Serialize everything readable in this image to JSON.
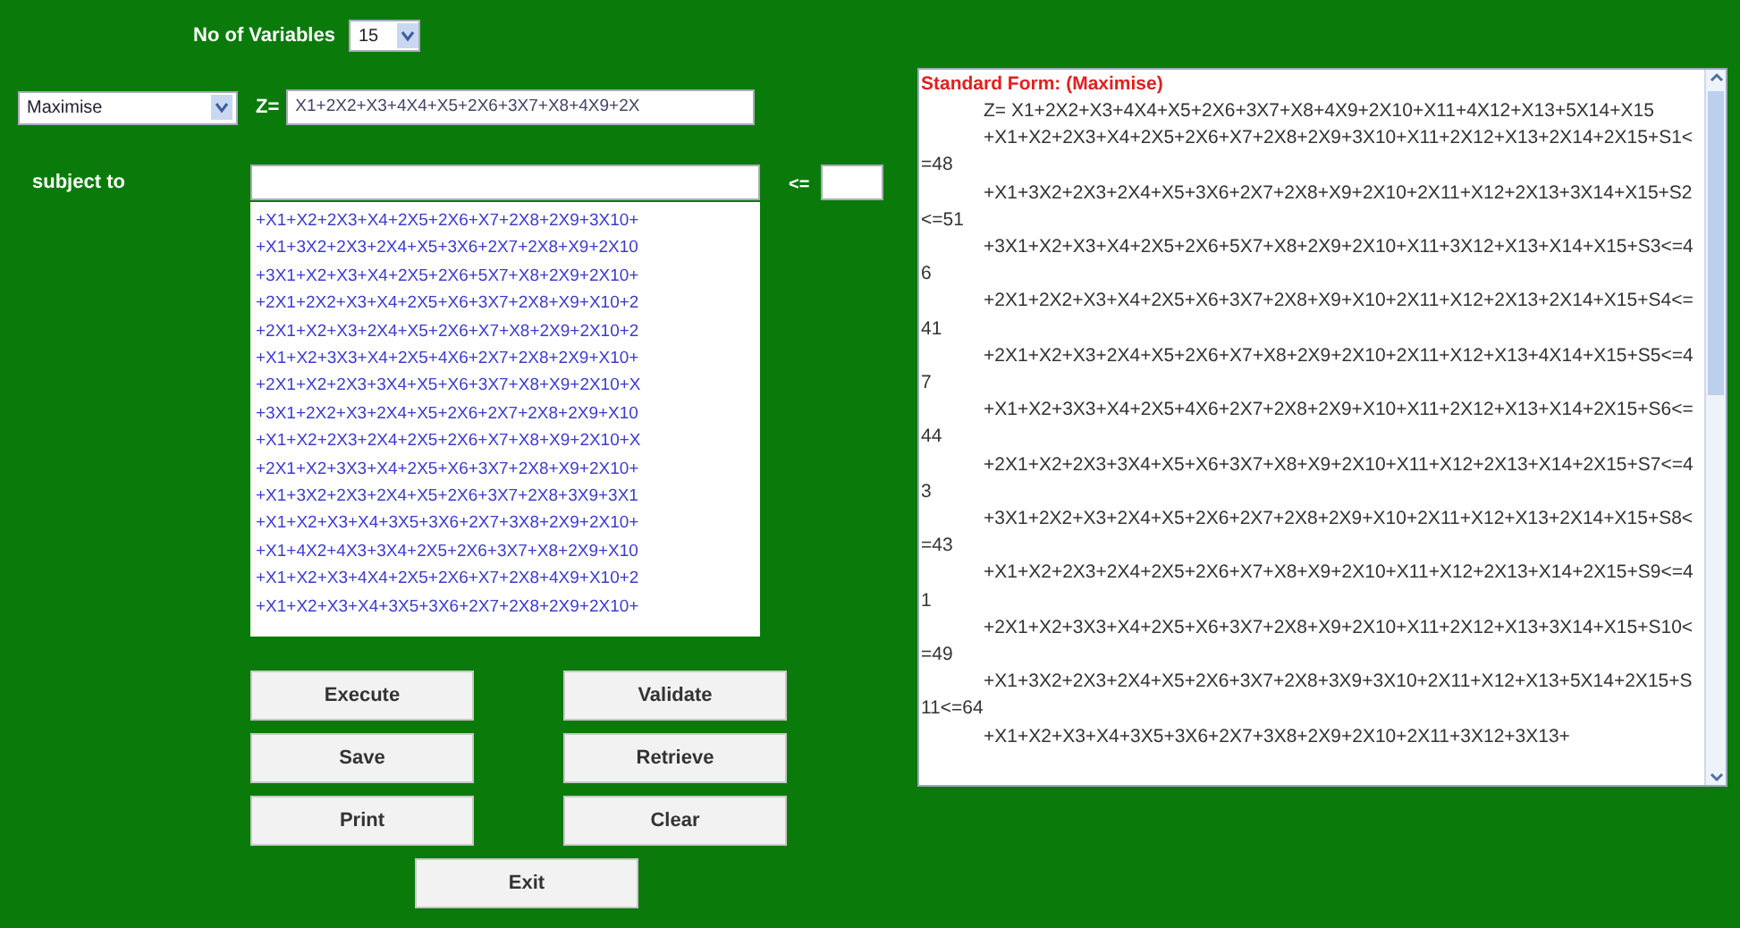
{
  "variables": {
    "label": "No of Variables",
    "value": "15"
  },
  "objective": {
    "mode": "Maximise",
    "label": "Z=",
    "value": "X1+2X2+X3+4X4+X5+2X6+3X7+X8+4X9+2X"
  },
  "constraints": {
    "label": "subject to",
    "relation": "<=",
    "lines": [
      "+X1+X2+2X3+X4+2X5+2X6+X7+2X8+2X9+3X10+",
      "+X1+3X2+2X3+2X4+X5+3X6+2X7+2X8+X9+2X10",
      "+3X1+X2+X3+X4+2X5+2X6+5X7+X8+2X9+2X10+",
      "+2X1+2X2+X3+X4+2X5+X6+3X7+2X8+X9+X10+2",
      "+2X1+X2+X3+2X4+X5+2X6+X7+X8+2X9+2X10+2",
      "+X1+X2+3X3+X4+2X5+4X6+2X7+2X8+2X9+X10+",
      "+2X1+X2+2X3+3X4+X5+X6+3X7+X8+X9+2X10+X",
      "+3X1+2X2+X3+2X4+X5+2X6+2X7+2X8+2X9+X10",
      "+X1+X2+2X3+2X4+2X5+2X6+X7+X8+X9+2X10+X",
      "+2X1+X2+3X3+X4+2X5+X6+3X7+2X8+X9+2X10+",
      "+X1+3X2+2X3+2X4+X5+2X6+3X7+2X8+3X9+3X1",
      "+X1+X2+X3+X4+3X5+3X6+2X7+3X8+2X9+2X10+",
      "+X1+4X2+4X3+3X4+2X5+2X6+3X7+X8+2X9+X10",
      "+X1+X2+X3+4X4+2X5+2X6+X7+2X8+4X9+X10+2",
      "+X1+X2+X3+X4+3X5+3X6+2X7+2X8+2X9+2X10+"
    ]
  },
  "buttons": [
    "Execute",
    "Validate",
    "Save",
    "Retrieve",
    "Print",
    "Clear",
    "Exit"
  ],
  "standard_form": {
    "title": "Standard Form: (Maximise)",
    "entries": [
      "Z= X1+2X2+X3+4X4+X5+2X6+3X7+X8+4X9+2X10+X11+4X12+X13+5X14+X15",
      "+X1+X2+2X3+X4+2X5+2X6+X7+2X8+2X9+3X10+X11+2X12+X13+2X14+2X15+S1<=48",
      "+X1+3X2+2X3+2X4+X5+3X6+2X7+2X8+X9+2X10+2X11+X12+2X13+3X14+X15+S2<=51",
      "+3X1+X2+X3+X4+2X5+2X6+5X7+X8+2X9+2X10+X11+3X12+X13+X14+X15+S3<=46",
      "+2X1+2X2+X3+X4+2X5+X6+3X7+2X8+X9+X10+2X11+X12+2X13+2X14+X15+S4<=41",
      "+2X1+X2+X3+2X4+X5+2X6+X7+X8+2X9+2X10+2X11+X12+X13+4X14+X15+S5<=47",
      "+X1+X2+3X3+X4+2X5+4X6+2X7+2X8+2X9+X10+X11+2X12+X13+X14+2X15+S6<=44",
      "+2X1+X2+2X3+3X4+X5+X6+3X7+X8+X9+2X10+X11+X12+2X13+X14+2X15+S7<=43",
      "+3X1+2X2+X3+2X4+X5+2X6+2X7+2X8+2X9+X10+2X11+X12+X13+2X14+X15+S8<=43",
      "+X1+X2+2X3+2X4+2X5+2X6+X7+X8+X9+2X10+X11+X12+2X13+X14+2X15+S9<=41",
      "+2X1+X2+3X3+X4+2X5+X6+3X7+2X8+X9+2X10+X11+2X12+X13+3X14+X15+S10<=49",
      "+X1+3X2+2X3+2X4+X5+2X6+3X7+2X8+3X9+3X10+2X11+X12+X13+5X14+2X15+S11<=64",
      "+X1+X2+X3+X4+3X5+3X6+2X7+3X8+2X9+2X10+2X11+3X12+3X13+"
    ]
  }
}
